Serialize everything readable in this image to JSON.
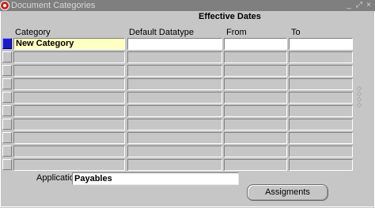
{
  "window": {
    "title": "Document Categories",
    "icon": "oracle-icon",
    "controls": [
      "_",
      "⤢",
      "×"
    ]
  },
  "section_header": "Effective Dates",
  "columns": {
    "category": "Category",
    "datatype": "Default Datatype",
    "from": "From",
    "to": "To"
  },
  "rows": [
    {
      "category": "New Category",
      "datatype": "",
      "from": "",
      "to": "",
      "current": true
    },
    {
      "category": "",
      "datatype": "",
      "from": "",
      "to": ""
    },
    {
      "category": "",
      "datatype": "",
      "from": "",
      "to": ""
    },
    {
      "category": "",
      "datatype": "",
      "from": "",
      "to": ""
    },
    {
      "category": "",
      "datatype": "",
      "from": "",
      "to": ""
    },
    {
      "category": "",
      "datatype": "",
      "from": "",
      "to": ""
    },
    {
      "category": "",
      "datatype": "",
      "from": "",
      "to": ""
    },
    {
      "category": "",
      "datatype": "",
      "from": "",
      "to": ""
    },
    {
      "category": "",
      "datatype": "",
      "from": "",
      "to": ""
    },
    {
      "category": "",
      "datatype": "",
      "from": "",
      "to": ""
    }
  ],
  "application": {
    "label": "Application",
    "value": "Payables"
  },
  "buttons": {
    "assignments": "Assigments"
  },
  "colors": {
    "background": "#c6c6c6",
    "titlebar": "#7f7f7f",
    "current_record": "#1a1acc",
    "current_field": "#ffffc0"
  }
}
